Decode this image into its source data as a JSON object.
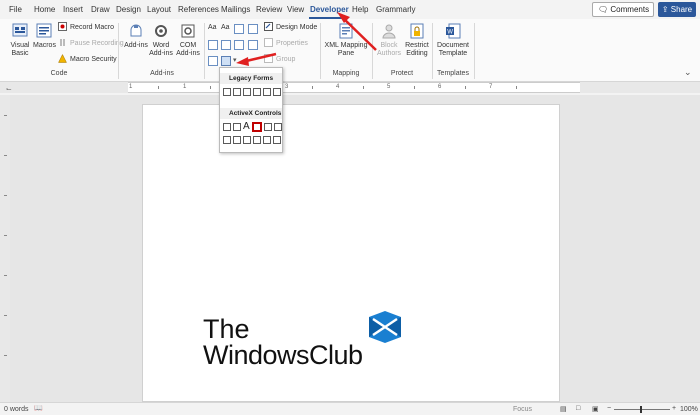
{
  "tabs": [
    "File",
    "Home",
    "Insert",
    "Draw",
    "Design",
    "Layout",
    "References",
    "Mailings",
    "Review",
    "View",
    "Developer",
    "Help",
    "Grammarly"
  ],
  "active_tab": "Developer",
  "header_buttons": {
    "comments": "Comments",
    "share": "Share"
  },
  "ribbon": {
    "code": {
      "label": "Code",
      "visual_basic": "Visual Basic",
      "macros": "Macros",
      "record_macro": "Record Macro",
      "pause_recording": "Pause Recording",
      "macro_security": "Macro Security"
    },
    "addins": {
      "label": "Add-ins",
      "addins": "Add-ins",
      "word_addins": "Word Add-ins",
      "com_addins": "COM Add-ins"
    },
    "controls": {
      "design_mode": "Design Mode",
      "properties": "Properties",
      "group": "Group"
    },
    "mapping": {
      "label": "Mapping",
      "xml_mapping_pane": "XML Mapping Pane"
    },
    "protect": {
      "label": "Protect",
      "block_authors": "Block Authors",
      "restrict_editing": "Restrict Editing"
    },
    "templates": {
      "label": "Templates",
      "document_template": "Document Template"
    }
  },
  "dropdown": {
    "legacy_forms": "Legacy Forms",
    "activex_controls": "ActiveX Controls"
  },
  "ruler_numbers": [
    "1",
    "1",
    "2",
    "3",
    "4",
    "5",
    "6",
    "7"
  ],
  "logo": {
    "line1": "The",
    "line2": "WindowsClub"
  },
  "status": {
    "words": "0 words",
    "focus": "Focus",
    "zoom": "100%"
  },
  "colors": {
    "accent": "#2b579a",
    "highlight_arrow": "#e02020"
  }
}
